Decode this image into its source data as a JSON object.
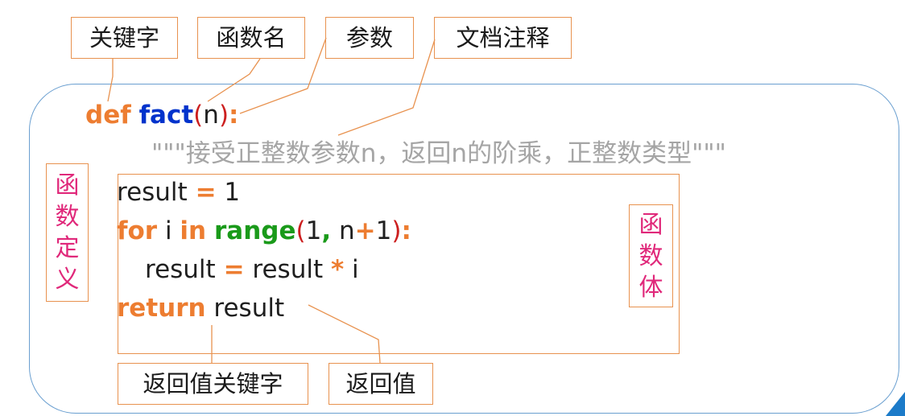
{
  "labels": {
    "keyword": "关键字",
    "func_name": "函数名",
    "param": "参数",
    "docstring": "文档注释",
    "return_keyword": "返回值关键字",
    "return_value": "返回值"
  },
  "side_labels": {
    "definition": [
      "函",
      "数",
      "定",
      "义"
    ],
    "body": [
      "函",
      "数",
      "体"
    ]
  },
  "code": {
    "line1": {
      "kw": "def",
      "fn": "fact",
      "open": "(",
      "arg": "n",
      "close": ")",
      "colon": ":"
    },
    "doc": "\"\"\"接受正整数参数n，返回n的阶乘，正整数类型\"\"\"",
    "line3": {
      "var": "result",
      "eq": "=",
      "num": "1"
    },
    "line4": {
      "kw_for": "for",
      "var": "i",
      "kw_in": "in",
      "bi": "range",
      "open": "(",
      "a": "1",
      "comma": ",",
      "n": "n",
      "plus": "+",
      "b": "1",
      "close": ")",
      "colon": ":"
    },
    "line5": {
      "lhs": "result",
      "eq": "=",
      "rhs": "result",
      "star": "*",
      "i": "i"
    },
    "line6": {
      "kw": "return",
      "val": "result"
    }
  },
  "colors": {
    "keyword": "#ed7d31",
    "function": "#0033cc",
    "builtin": "#1a9a1a",
    "paren": "#cc1f1f",
    "docstring": "#a5a5a5",
    "side_label": "#e0287a",
    "box_border": "#e8924f",
    "outer_border": "#6a9fd0"
  }
}
